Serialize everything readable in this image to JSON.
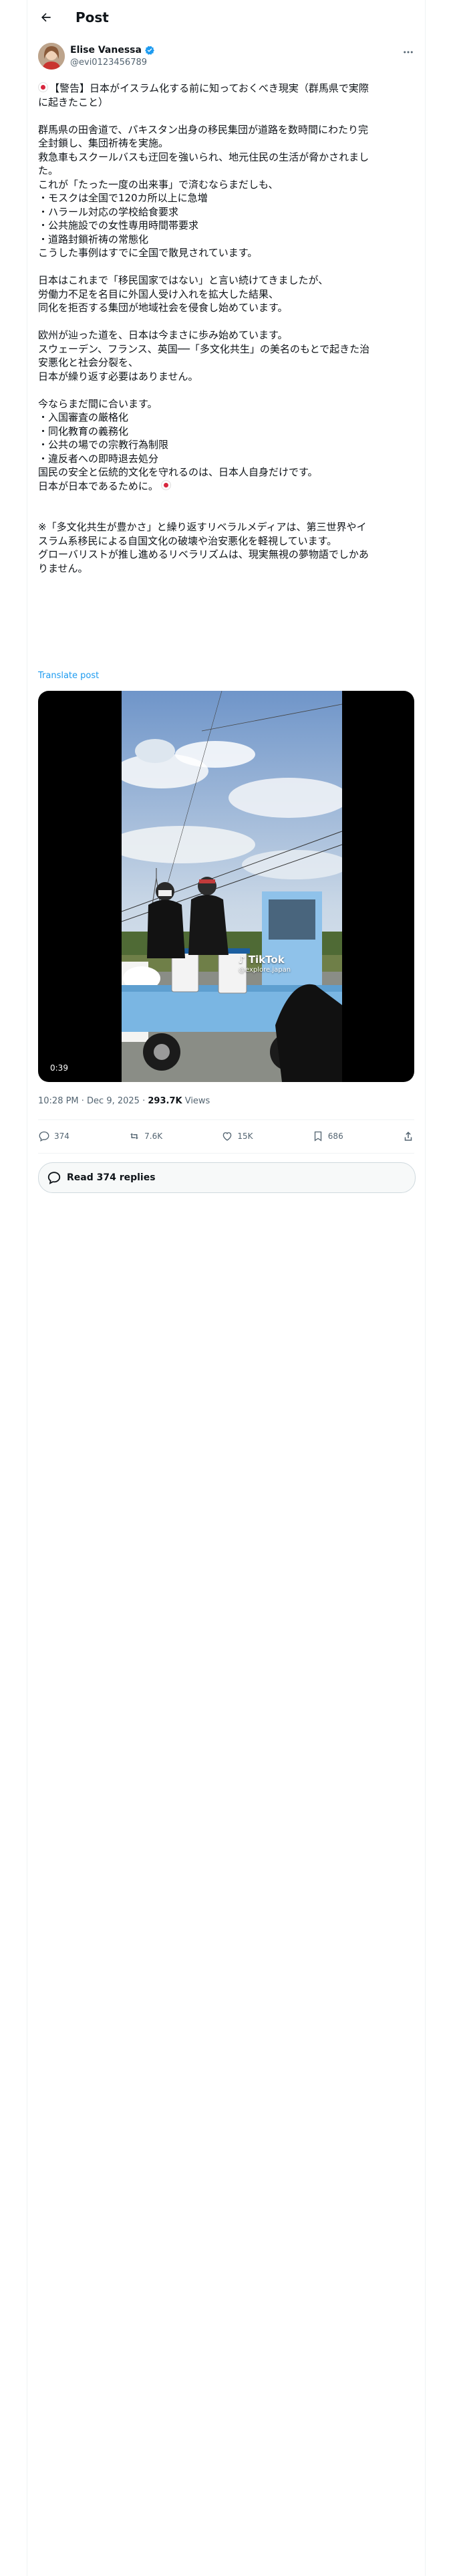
{
  "header": {
    "title": "Post",
    "back_icon": "arrow-left-icon"
  },
  "author": {
    "name": "Elise Vanessa",
    "handle": "@evi0123456789",
    "verified": true,
    "verified_color": "#1d9bf0"
  },
  "tweet": {
    "lines": [
      "【警告】日本がイスラム化する前に知っておくべき現実（群馬県で実際",
      "に起きたこと）",
      "",
      "群馬県の田舎道で、パキスタン出身の移民集団が道路を数時間にわたり完",
      "全封鎖し、集団祈祷を実施。",
      "救急車もスクールバスも迂回を強いられ、地元住民の生活が脅かされまし",
      "た。",
      "これが「たった一度の出来事」で済むならまだしも、",
      "・モスクは全国で120カ所以上に急増",
      "・ハラール対応の学校給食要求",
      "・公共施設での女性専用時間帯要求",
      "・道路封鎖祈祷の常態化",
      "こうした事例はすでに全国で散見されています。",
      "",
      "日本はこれまで「移民国家ではない」と言い続けてきましたが、",
      "労働力不足を名目に外国人受け入れを拡大した結果、",
      "同化を拒否する集団が地域社会を侵食し始めています。",
      "",
      "欧州が辿った道を、日本は今まさに歩み始めています。",
      "スウェーデン、フランス、英国──「多文化共生」の美名のもとで起きた治",
      "安悪化と社会分裂を、",
      "日本が繰り返す必要はありません。",
      "",
      "今ならまだ間に合います。",
      "・入国審査の厳格化",
      "・同化教育の義務化",
      "・公共の場での宗教行為制限",
      "・違反者への即時退去処分",
      "国民の安全と伝統的文化を守れるのは、日本人自身だけです。",
      "日本が日本であるために。",
      "",
      "",
      "※「多文化共生が豊かさ」と繰り返すリベラルメディアは、第三世界やイ",
      "スラム系移民による自国文化の破壊や治安悪化を軽視しています。",
      "グローバリストが推し進めるリベラリズムは、現実無視の夢物語でしかあ",
      "りません。"
    ],
    "flag_before_line": 0,
    "flag_after_line": 29,
    "translate_label": "Translate post"
  },
  "media": {
    "duration": "0:39",
    "watermark_name": "TikTok",
    "watermark_handle": "@explore.japan"
  },
  "meta": {
    "time": "10:28 PM · Dec 9, 2025",
    "dot": " · ",
    "views_count": "293.7K",
    "views_label": " Views"
  },
  "actions": {
    "replies": "374",
    "reposts": "7.6K",
    "likes": "15K",
    "bookmarks": "686"
  },
  "read_replies": "Read 374 replies",
  "colors": {
    "accent": "#1d9bf0",
    "secondary_text": "#536471",
    "border": "#eff3f4"
  }
}
